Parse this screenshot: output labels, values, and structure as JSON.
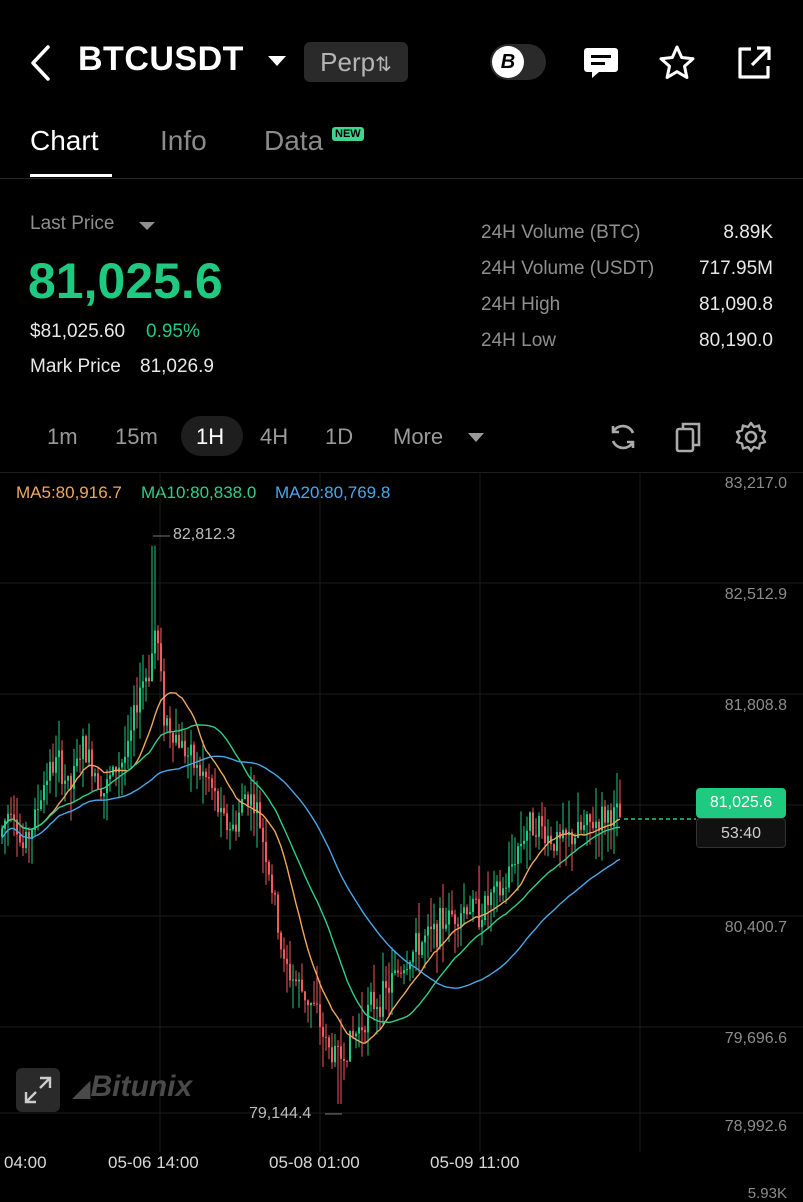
{
  "header": {
    "symbol": "BTCUSDT",
    "contract_type": "Perp",
    "b_toggle": "B"
  },
  "tabs": [
    {
      "label": "Chart"
    },
    {
      "label": "Info"
    },
    {
      "label": "Data"
    }
  ],
  "new_badge": "NEW",
  "summary": {
    "last_price_label": "Last Price",
    "last_price": "81,025.6",
    "usd_price": "$81,025.60",
    "change_pct": "0.95%",
    "mark_price_label": "Mark Price",
    "mark_price": "81,026.9",
    "stats": [
      {
        "label": "24H Volume (BTC)",
        "value": "8.89K"
      },
      {
        "label": "24H Volume (USDT)",
        "value": "717.95M"
      },
      {
        "label": "24H High",
        "value": "81,090.8"
      },
      {
        "label": "24H Low",
        "value": "80,190.0"
      }
    ]
  },
  "timeframes": [
    "1m",
    "15m",
    "1H",
    "4H",
    "1D",
    "More"
  ],
  "active_timeframe": "1H",
  "indicators": {
    "ma5": "MA5:80,916.7",
    "ma10": "MA10:80,838.0",
    "ma20": "MA20:80,769.8"
  },
  "colors": {
    "up": "#20c980",
    "down": "#f0595f",
    "ma5": "#f0a95a",
    "ma10": "#2fcf8a",
    "ma20": "#4aa8e8"
  },
  "chart_data": {
    "type": "candlestick",
    "y_ticks": [
      "83,217.0",
      "82,512.9",
      "81,808.8",
      "81,025.6",
      "80,400.7",
      "79,696.6",
      "78,992.6"
    ],
    "ylim": [
      78992.6,
      83217.0
    ],
    "x_ticks": [
      "04:00",
      "05-06 14:00",
      "05-08 01:00",
      "05-09 11:00"
    ],
    "high_label": "82,812.3",
    "low_label": "79,144.4",
    "current_price": "81,025.6",
    "countdown": "53:40"
  },
  "watermark": "Bitunix",
  "volume_axis_label": "5.93K"
}
